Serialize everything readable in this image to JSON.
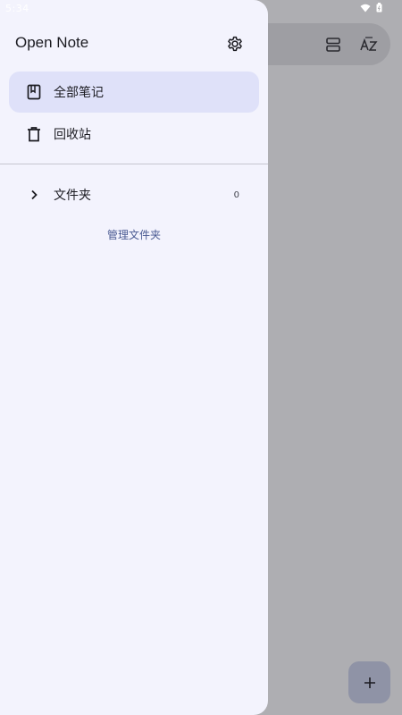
{
  "status_bar": {
    "time": "5:34",
    "icons": [
      "wifi-icon",
      "battery-icon"
    ]
  },
  "background_app": {
    "search_bar": {
      "icons": [
        "view-layout-icon",
        "sort-az-icon"
      ]
    },
    "fab": {
      "label": "+"
    }
  },
  "drawer": {
    "title": "Open Note",
    "settings_icon": "gear-icon",
    "nav_items": [
      {
        "label": "全部笔记",
        "icon": "notebook-icon",
        "active": true
      },
      {
        "label": "回收站",
        "icon": "trash-icon",
        "active": false
      }
    ],
    "folders": {
      "label": "文件夹",
      "count": "0",
      "icon": "chevron-right-icon"
    },
    "manage_folders_label": "管理文件夹"
  },
  "colors": {
    "drawer_bg": "#f3f3fd",
    "active_item_bg": "#dfe1f9",
    "link": "#4a5a92",
    "scrim": "#aeaeb2"
  }
}
